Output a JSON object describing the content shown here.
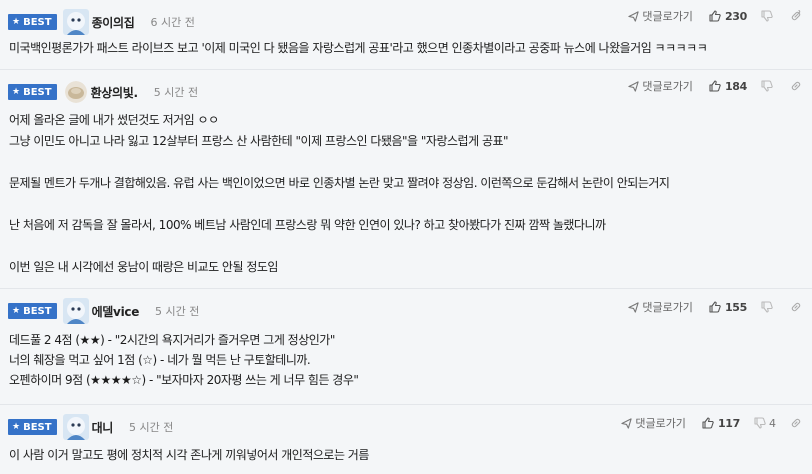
{
  "badge": "BEST",
  "reply_label": "댓글로가기",
  "comments": [
    {
      "nickname": "종이의집",
      "time": "6 시간 전",
      "likes": "230",
      "dislikes": "",
      "lines": [
        "미국백인평론가가 패스트 라이브즈 보고 '이제 미국인 다 됐음을 자랑스럽게 공표'라고 했으면 인종차별이라고 공중파 뉴스에 나왔을거임 ㅋㅋㅋㅋㅋ"
      ]
    },
    {
      "nickname": "환상의빛.",
      "time": "5 시간 전",
      "likes": "184",
      "dislikes": "",
      "lines": [
        "어제 올라온 글에 내가 썼던것도 저거임 ㅇㅇ",
        "그냥 이민도 아니고 나라 잃고 12살부터 프랑스 산 사람한테 \"이제 프랑스인 다됐음\"을 \"자랑스럽게 공표\"",
        "",
        "문제될 멘트가 두개나 결합해있음. 유럽 사는 백인이었으면 바로 인종차별 논란 맞고 짤려야 정상임. 이런쪽으로 둔감해서 논란이 안되는거지",
        "",
        "난 처음에 저 감독을 잘 몰라서, 100% 베트남 사람인데 프랑스랑 뭐 약한 인연이 있나? 하고 찾아봤다가 진짜 깜짝 놀랬다니까",
        "",
        "이번 일은 내 시각에선 웅남이 때랑은 비교도 안될 정도임"
      ]
    },
    {
      "nickname": "에델vice",
      "time": "5 시간 전",
      "likes": "155",
      "dislikes": "",
      "lines": [
        "데드풀 2 4점 (★★) - \"2시간의 욕지거리가 즐거우면 그게 정상인가\"",
        "너의 췌장을 먹고 싶어 1점 (☆) - 네가 뭘 먹든 난 구토할테니까.",
        "오펜하이머 9점 (★★★★☆) - \"보자마자 20자평 쓰는 게 너무 힘든 경우\""
      ]
    },
    {
      "nickname": "대니",
      "time": "5 시간 전",
      "likes": "117",
      "dislikes": "4",
      "lines": [
        "이 사람 이거 말고도 평에 정치적 시각 존나게 끼워넣어서 개인적으로는 거름"
      ]
    }
  ]
}
